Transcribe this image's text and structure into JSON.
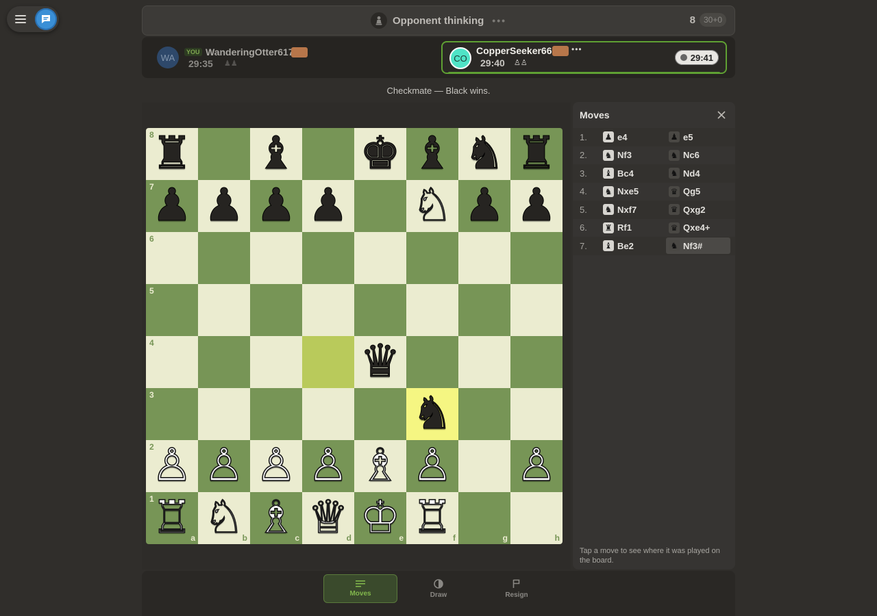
{
  "status": {
    "text": "Opponent thinking",
    "dots": "•••",
    "move_count": "8",
    "time_control": "30+0"
  },
  "players": {
    "you": {
      "initials": "WA",
      "tag": "YOU",
      "name": "WanderingOtter617",
      "clock": "29:35",
      "captured": "♟♟"
    },
    "opponent": {
      "initials": "CO",
      "name": "CopperSeeker661",
      "more": "•••",
      "clock_left": "29:40",
      "captured": "♙♙",
      "clock_right": "29:41"
    }
  },
  "result": "Checkmate — Black wins.",
  "board": {
    "ranks": [
      [
        {
          "p": "♜",
          "c": "b"
        },
        null,
        {
          "p": "♝",
          "c": "b"
        },
        null,
        {
          "p": "♚",
          "c": "b"
        },
        {
          "p": "♝",
          "c": "b"
        },
        {
          "p": "♞",
          "c": "b"
        },
        {
          "p": "♜",
          "c": "b"
        }
      ],
      [
        {
          "p": "♟",
          "c": "b"
        },
        {
          "p": "♟",
          "c": "b"
        },
        {
          "p": "♟",
          "c": "b"
        },
        {
          "p": "♟",
          "c": "b"
        },
        null,
        {
          "p": "♘",
          "c": "w"
        },
        {
          "p": "♟",
          "c": "b"
        },
        {
          "p": "♟",
          "c": "b"
        }
      ],
      [
        null,
        null,
        null,
        null,
        null,
        null,
        null,
        null
      ],
      [
        null,
        null,
        null,
        null,
        null,
        null,
        null,
        null
      ],
      [
        null,
        null,
        null,
        null,
        {
          "p": "♛",
          "c": "b"
        },
        null,
        null,
        null
      ],
      [
        null,
        null,
        null,
        null,
        null,
        {
          "p": "♞",
          "c": "b"
        },
        null,
        null
      ],
      [
        {
          "p": "♙",
          "c": "w"
        },
        {
          "p": "♙",
          "c": "w"
        },
        {
          "p": "♙",
          "c": "w"
        },
        {
          "p": "♙",
          "c": "w"
        },
        {
          "p": "♗",
          "c": "w"
        },
        {
          "p": "♙",
          "c": "w"
        },
        null,
        {
          "p": "♙",
          "c": "w"
        }
      ],
      [
        {
          "p": "♖",
          "c": "w"
        },
        {
          "p": "♘",
          "c": "w"
        },
        {
          "p": "♗",
          "c": "w"
        },
        {
          "p": "♕",
          "c": "w"
        },
        {
          "p": "♔",
          "c": "w"
        },
        {
          "p": "♖",
          "c": "w"
        },
        null,
        null
      ]
    ],
    "highlights": [
      "d4",
      "f3"
    ],
    "rank_labels": [
      "8",
      "7",
      "6",
      "5",
      "4",
      "3",
      "2",
      "1"
    ],
    "file_labels": [
      "a",
      "b",
      "c",
      "d",
      "e",
      "f",
      "g",
      "h"
    ]
  },
  "moves_panel": {
    "title": "Moves",
    "moves": [
      {
        "no": "1.",
        "white": "e4",
        "white_icon": "♟",
        "black": "e5",
        "black_icon": "♟"
      },
      {
        "no": "2.",
        "white": "Nf3",
        "white_icon": "♞",
        "black": "Nc6",
        "black_icon": "♞"
      },
      {
        "no": "3.",
        "white": "Bc4",
        "white_icon": "♝",
        "black": "Nd4",
        "black_icon": "♞"
      },
      {
        "no": "4.",
        "white": "Nxe5",
        "white_icon": "♞",
        "black": "Qg5",
        "black_icon": "♛"
      },
      {
        "no": "5.",
        "white": "Nxf7",
        "white_icon": "♞",
        "black": "Qxg2",
        "black_icon": "♛"
      },
      {
        "no": "6.",
        "white": "Rf1",
        "white_icon": "♜",
        "black": "Qxe4+",
        "black_icon": "♛"
      },
      {
        "no": "7.",
        "white": "Be2",
        "white_icon": "♝",
        "black": "Nf3#",
        "black_icon": "♞"
      }
    ],
    "active_move": "Nf3#",
    "hint": "Tap a move to see where it was played on the board."
  },
  "bottom_tabs": [
    {
      "label": "Moves",
      "icon": "moves-icon",
      "active": true
    },
    {
      "label": "Draw",
      "icon": "draw-icon",
      "active": false
    },
    {
      "label": "Resign",
      "icon": "flag-icon",
      "active": false
    }
  ],
  "colors": {
    "board_light": "#ebecd0",
    "board_dark": "#779556",
    "highlight_light": "#f5f682",
    "highlight_dark": "#b9ca5b",
    "accent_green": "#81b64c",
    "chat_blue": "#3a8fd6"
  }
}
